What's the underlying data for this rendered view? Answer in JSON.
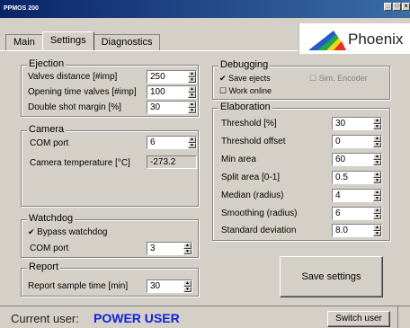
{
  "window": {
    "title": "PPMOS 200",
    "controls": [
      "_",
      "□",
      "x"
    ]
  },
  "tabs": [
    "Main",
    "Settings",
    "Diagnostics"
  ],
  "logo": {
    "text": "Phoenix"
  },
  "ejection": {
    "title": "Ejection",
    "rows": [
      {
        "label": "Valves distance [#imp]",
        "value": "250"
      },
      {
        "label": "Opening time valves [#imp]",
        "value": "100"
      },
      {
        "label": "Double shot margin [%]",
        "value": "30"
      }
    ]
  },
  "camera": {
    "title": "Camera",
    "com_label": "COM port",
    "com_value": "6",
    "temp_label": "Camera temperature [°C]",
    "temp_value": "-273.2"
  },
  "watchdog": {
    "title": "Watchdog",
    "bypass_label": "Bypass watchdog",
    "com_label": "COM port",
    "com_value": "3"
  },
  "report": {
    "title": "Report",
    "label": "Report sample time [min]",
    "value": "30"
  },
  "debugging": {
    "title": "Debugging",
    "save_ejects": "Save ejects",
    "sim_encoder": "Sim. Encoder",
    "work_online": "Work online"
  },
  "elaboration": {
    "title": "Elaboration",
    "rows": [
      {
        "label": "Threshold [%]",
        "value": "30"
      },
      {
        "label": "Threshold offset",
        "value": "0"
      },
      {
        "label": "Min area",
        "value": "60"
      },
      {
        "label": "Split area [0-1]",
        "value": "0.5"
      },
      {
        "label": "Median (radius)",
        "value": "4"
      },
      {
        "label": "Smoothing (radius)",
        "value": "6"
      },
      {
        "label": "Standard deviation",
        "value": "8.0"
      }
    ]
  },
  "buttons": {
    "save": "Save settings",
    "switch_user": "Switch user"
  },
  "status": {
    "label": "Current user:",
    "user": "POWER USER"
  }
}
